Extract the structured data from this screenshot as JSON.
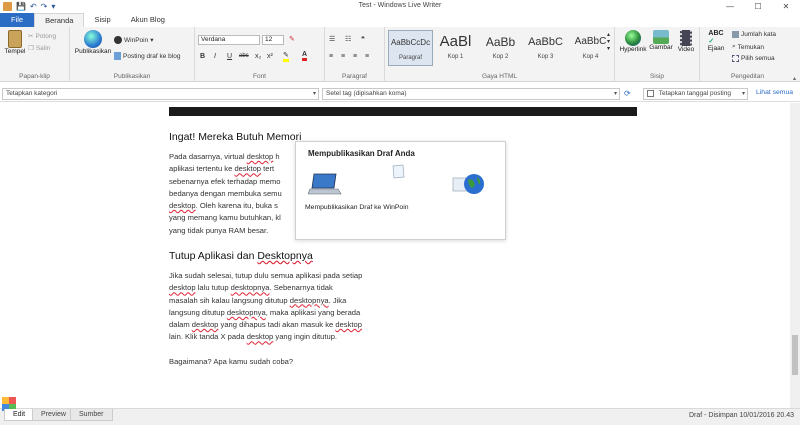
{
  "window": {
    "title": "Test - Windows Live Writer",
    "controls": [
      "—",
      "☐",
      "✕"
    ]
  },
  "quick_access": [
    "💾",
    "↶",
    "↷",
    "▾"
  ],
  "tabs": [
    {
      "label": "File"
    },
    {
      "label": "Beranda"
    },
    {
      "label": "Sisip"
    },
    {
      "label": "Akun Blog"
    }
  ],
  "ribbon": {
    "clipboard": {
      "label": "Papan-klip",
      "paste": "Tempel",
      "cut": "Potong",
      "copy": "Salin"
    },
    "publish": {
      "label": "Publikasikan",
      "publish_btn": "Publikasikan",
      "account": "WinPoin",
      "post_draft": "Posting draf ke blog"
    },
    "font": {
      "label": "Font",
      "family": "Verdana",
      "size": "12",
      "bold": "B",
      "italic": "I",
      "underline": "U",
      "strike": "abc",
      "sub": "x₂",
      "sup": "x²"
    },
    "paragraph": {
      "label": "Paragraf"
    },
    "html_style": {
      "label": "Gaya HTML",
      "styles": [
        {
          "preview": "AaBbCcDc",
          "label": "Paragraf"
        },
        {
          "preview": "AaBl",
          "label": "Kop 1"
        },
        {
          "preview": "AaBb",
          "label": "Kop 2"
        },
        {
          "preview": "AaBbC",
          "label": "Kop 3"
        },
        {
          "preview": "AaBbC",
          "label": "Kop 4"
        }
      ]
    },
    "insert": {
      "label": "Sisip",
      "hyperlink": "Hyperlink",
      "picture": "Gambar",
      "video": "Video"
    },
    "editing": {
      "label": "Pengeditan",
      "spelling": "Ejaan",
      "word_count": "Jumlah kata",
      "find": "Temukan",
      "select_all": "Pilih semua"
    }
  },
  "category_bar": {
    "category_placeholder": "Tetapkan kategori",
    "tags_placeholder": "Setel tag (dipisahkan koma)",
    "date_checkbox": "Tetapkan tanggal posting",
    "see_all": "Lihat semua"
  },
  "article": {
    "heading1": "Ingat! Mereka Butuh Memori",
    "para1": [
      "Pada dasarnya, virtual desktop h",
      "aplikasi tertentu ke desktop tert",
      "sebenarnya efek terhadap memo",
      "bedanya dengan membuka semu",
      "desktop. Oleh karena itu, buka s",
      "yang memang kamu butuhkan, kl",
      "yang tidak punya RAM besar."
    ],
    "heading2": "Tutup Aplikasi dan Desktopnya",
    "para2": [
      "Jika sudah selesai, tutup dulu semua aplikasi pada setiap",
      "desktop lalu tutup desktopnya. Sebenarnya tidak",
      "masalah sih kalau langsung ditutup desktopnya. Jika",
      "langsung ditutup desktopnya, maka aplikasi yang berada",
      "dalam desktop yang dihapus tadi  akan masuk ke desktop",
      "lain. Klik tanda X pada desktop yang ingin ditutup."
    ],
    "para3": "Bagaimana? Apa kamu sudah coba?"
  },
  "dialog": {
    "title": "Mempublikasikan Draf Anda",
    "label": "Mempublikasikan Draf ke WinPoin"
  },
  "status": {
    "views": [
      "Edit",
      "Preview",
      "Sumber"
    ],
    "text": "Draf - Disimpan 10/01/2016 20.43"
  }
}
